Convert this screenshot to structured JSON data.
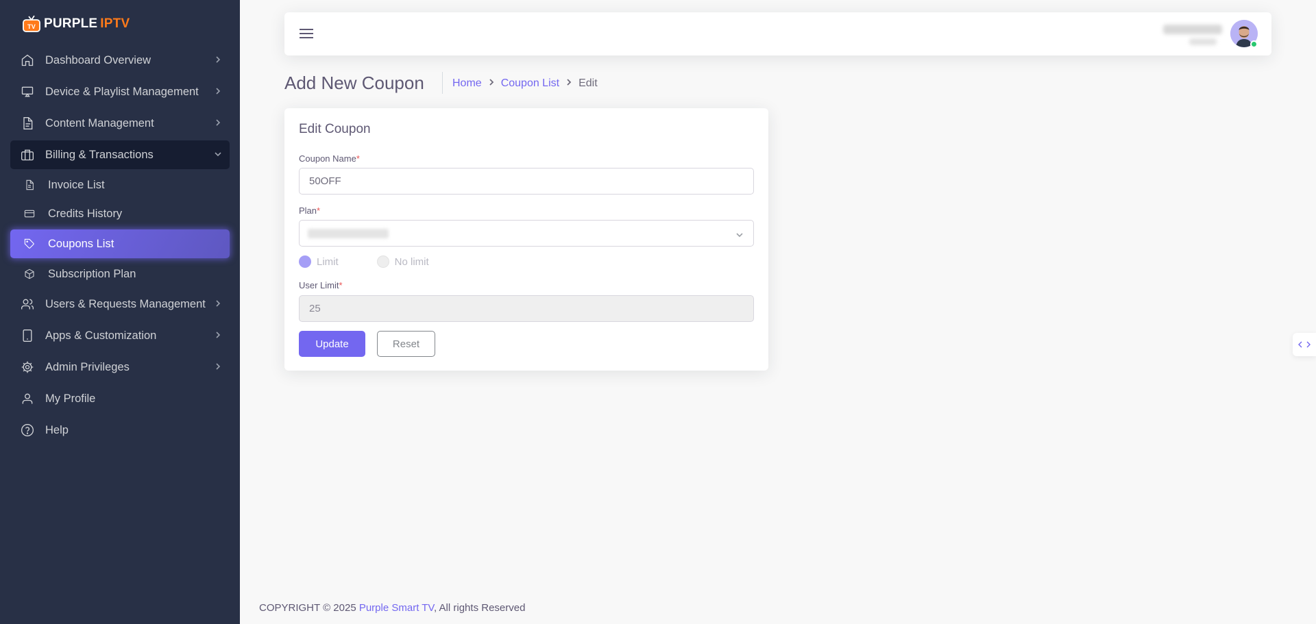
{
  "brand": {
    "part1": "PURPLE",
    "part2": "IPTV",
    "logo_text": "TV"
  },
  "sidebar": {
    "items": [
      {
        "label": "Dashboard Overview",
        "icon": "home-icon"
      },
      {
        "label": "Device & Playlist Management",
        "icon": "monitor-icon"
      },
      {
        "label": "Content Management",
        "icon": "file-text-icon"
      },
      {
        "label": "Billing & Transactions",
        "icon": "briefcase-icon"
      },
      {
        "label": "Users & Requests Management",
        "icon": "users-icon"
      },
      {
        "label": "Apps & Customization",
        "icon": "tablet-icon"
      },
      {
        "label": "Admin Privileges",
        "icon": "settings-icon"
      },
      {
        "label": "My Profile",
        "icon": "user-icon"
      },
      {
        "label": "Help",
        "icon": "help-circle-icon"
      }
    ],
    "billing_sub": [
      {
        "label": "Invoice List",
        "icon": "file-icon"
      },
      {
        "label": "Credits History",
        "icon": "credit-card-icon"
      },
      {
        "label": "Coupons List",
        "icon": "tag-icon"
      },
      {
        "label": "Subscription Plan",
        "icon": "package-icon"
      }
    ]
  },
  "header": {
    "title": "Add New Coupon",
    "breadcrumb": {
      "home": "Home",
      "list": "Coupon List",
      "current": "Edit"
    }
  },
  "form": {
    "card_title": "Edit Coupon",
    "coupon_name_label": "Coupon Name",
    "coupon_name_value": "50OFF",
    "plan_label": "Plan",
    "radio_limit": "Limit",
    "radio_no_limit": "No limit",
    "user_limit_label": "User Limit",
    "user_limit_value": "25",
    "required_mark": "*",
    "update_label": "Update",
    "reset_label": "Reset"
  },
  "footer": {
    "prefix": "COPYRIGHT © 2025 ",
    "brand": "Purple Smart TV",
    "suffix": ", All rights Reserved"
  },
  "colors": {
    "primary": "#7367f0",
    "sidebar_bg": "#283046",
    "active_group_bg": "#161d31",
    "required": "#ea5455",
    "logo_orange": "#ff7a1a",
    "online_status": "#28c76f"
  }
}
